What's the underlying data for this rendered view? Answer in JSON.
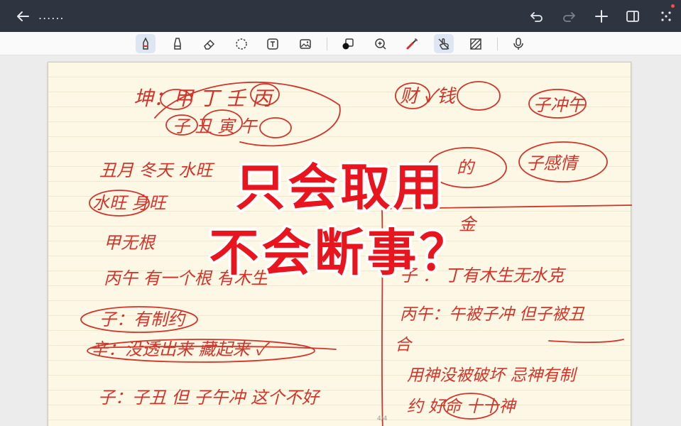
{
  "topbar": {
    "title": "......",
    "icons": [
      "back-arrow-icon",
      "undo-icon",
      "redo-icon",
      "add-icon",
      "sidebar-toggle-icon",
      "more-dots-icon"
    ],
    "notification_color": "#ff4a4a"
  },
  "toolbar": {
    "tools": [
      "pen-tool",
      "highlighter-tool",
      "eraser-tool",
      "lasso-tool",
      "text-tool",
      "image-tool",
      "shape-tool",
      "zoom-tool",
      "laser-pointer-tool",
      "hand-touch-tool",
      "pattern-tool",
      "microphone-tool"
    ],
    "active_tools": [
      "pen-tool",
      "hand-touch-tool"
    ]
  },
  "page": {
    "indicator": "4/4",
    "ink_color": "#d0352b"
  },
  "overlay": {
    "line1": "只会取用",
    "line2": "不会断事？",
    "color": "#e8141e"
  },
  "handwriting": {
    "left_top": "坤：甲 丁 壬 丙",
    "left_top_2": "子 丑 寅 午",
    "left_row2": "丑月 冬天 水旺",
    "left_row3": "水旺 身旺",
    "left_row4": "甲无根",
    "left_row5": "丙午 有一个根 有木生",
    "left_row6": "子：有制约",
    "left_row7": "辛：没透出来 藏起来 ✓",
    "left_row8": "子：子丑 但 子午冲 这个不好",
    "right_row1": "财 ✓钱",
    "right_row1b": "子冲午",
    "right_row2": "的",
    "right_row2b": "子感情",
    "right_row3": "金",
    "right_row4": "子 ： 丁有木生无水克",
    "right_row5": "丙午：午被子冲 但子被丑",
    "right_row6": "合",
    "right_row7": "用神没被破坏 忌神有制",
    "right_row8": "约 好命 十十神"
  }
}
